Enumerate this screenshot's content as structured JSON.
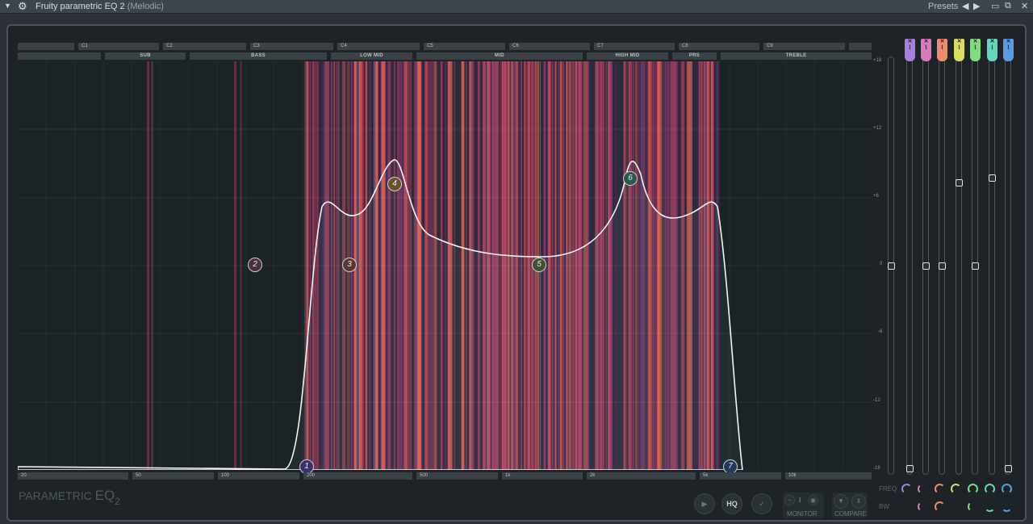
{
  "window": {
    "title": "Fruity parametric EQ 2",
    "subtitle": "(Melodic)",
    "presets_label": "Presets",
    "prev_icon": "◀",
    "next_icon": "▶",
    "restore_icon": "▭",
    "maximize_icon": "⧉",
    "close_icon": "✕",
    "menu_icon": "▼",
    "gear_icon": "⚙"
  },
  "octave_labels": [
    "",
    "C1",
    "C2",
    "C3",
    "C4",
    "C5",
    "C6",
    "C7",
    "C8",
    "C9",
    ""
  ],
  "range_labels": [
    "",
    "SUB",
    "BASS",
    "LOW MID",
    "MID",
    "HIGH MID",
    "PRS",
    "TREBLE"
  ],
  "freq_labels": [
    "20",
    "50",
    "100",
    "200",
    "500",
    "1k",
    "2k",
    "5k",
    "10k"
  ],
  "gain_labels": [
    "+18",
    "+12",
    "+6",
    "0",
    "-6",
    "-12",
    "-18"
  ],
  "nodes": [
    {
      "label": "1",
      "color": "#7e6bd6"
    },
    {
      "label": "2",
      "color": "#e27fa6"
    },
    {
      "label": "3",
      "color": "#f07862"
    },
    {
      "label": "4",
      "color": "#f1b23e"
    },
    {
      "label": "5",
      "color": "#93d66a"
    },
    {
      "label": "6",
      "color": "#5fd1b0"
    },
    {
      "label": "7",
      "color": "#4b8fe0"
    }
  ],
  "band_tabs": [
    {
      "color": "#a77fdc"
    },
    {
      "color": "#d77bbd"
    },
    {
      "color": "#ef8a6d"
    },
    {
      "color": "#d9de62"
    },
    {
      "color": "#7fdc80"
    },
    {
      "color": "#63d6bd"
    },
    {
      "color": "#5a9be4"
    }
  ],
  "brand": {
    "text": "PARAMETRIC",
    "eq": "EQ",
    "two": "2"
  },
  "controls": {
    "freq_label": "FREQ",
    "bw_label": "BW",
    "hq_label": "HQ",
    "monitor_label": "MONITOR",
    "compare_label": "COMPARE",
    "monitor_mid": "I"
  }
}
